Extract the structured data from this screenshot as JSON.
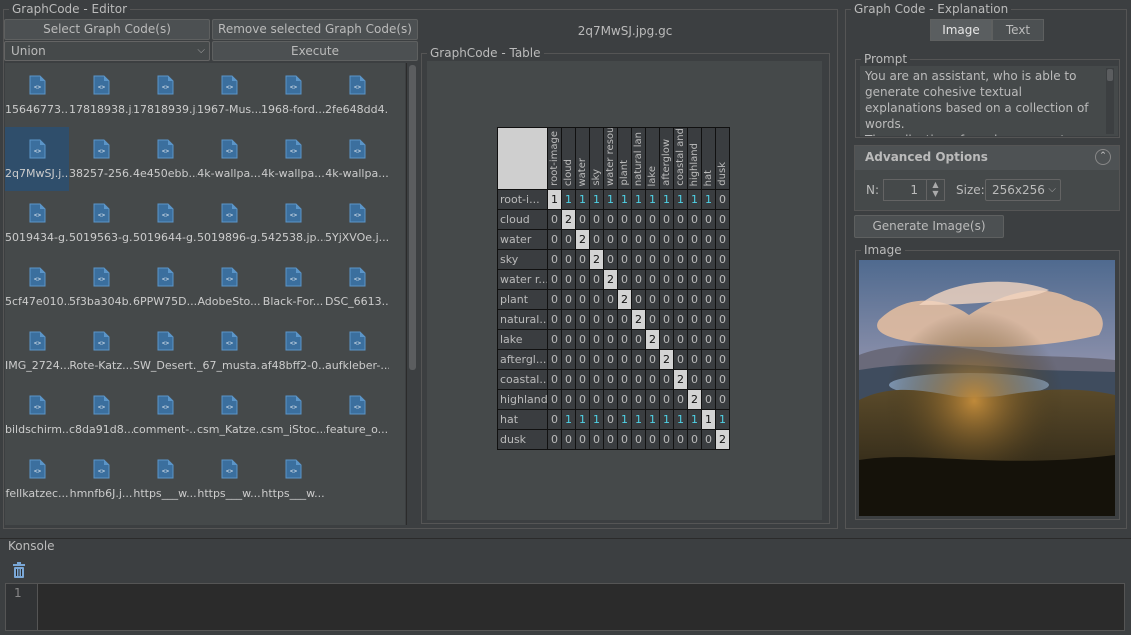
{
  "editor": {
    "title": "GraphCode - Editor",
    "select_button": "Select Graph Code(s)",
    "remove_button": "Remove selected Graph Code(s)",
    "mode_select": "Union",
    "execute_button": "Execute",
    "files": [
      "15646773...",
      "17818938.j...",
      "17818939.j...",
      "1967-Mus...",
      "1968-ford...",
      "2fe648dd4...",
      "2q7MwSJ.j...",
      "38257-256...",
      "4e450ebb...",
      "4k-wallpa...",
      "4k-wallpa...",
      "4k-wallpa...",
      "5019434-g...",
      "5019563-g...",
      "5019644-g...",
      "5019896-g...",
      "542538.jp...",
      "5YjXVOe.j...",
      "5cf47e010...",
      "5f3ba304b...",
      "6PPW75D...",
      "AdobeSto...",
      "Black-For...",
      "DSC_6613....",
      "IMG_2724....",
      "Rote-Katz...",
      "SW_Desert...",
      "_67_musta...",
      "af48bff2-0...",
      "aufkleber-...",
      "bildschirm...",
      "c8da91d8...",
      "comment-...",
      "csm_Katze...",
      "csm_iStoc...",
      "feature_o...",
      "fellkatzec...",
      "hmnfb6J.j...",
      "https___w...",
      "https___w...",
      "https___w..."
    ],
    "selected_file_index": 6
  },
  "table": {
    "file_title": "2q7MwSJ.jpg.gc",
    "title": "GraphCode - Table",
    "columns": [
      "root-image",
      "cloud",
      "water",
      "sky",
      "water resou.",
      "plant",
      "natural lan",
      "lake",
      "afterglow",
      "coastal and",
      "highland",
      "hat",
      "dusk"
    ],
    "row_labels": [
      "root-i...",
      "cloud",
      "water",
      "sky",
      "water r...",
      "plant",
      "natural...",
      "lake",
      "aftergl...",
      "coastal...",
      "highland",
      "hat",
      "dusk"
    ],
    "matrix": [
      [
        1,
        1,
        1,
        1,
        1,
        1,
        1,
        1,
        1,
        1,
        1,
        1,
        0
      ],
      [
        0,
        2,
        0,
        0,
        0,
        0,
        0,
        0,
        0,
        0,
        0,
        0,
        0
      ],
      [
        0,
        0,
        2,
        0,
        0,
        0,
        0,
        0,
        0,
        0,
        0,
        0,
        0
      ],
      [
        0,
        0,
        0,
        2,
        0,
        0,
        0,
        0,
        0,
        0,
        0,
        0,
        0
      ],
      [
        0,
        0,
        0,
        0,
        2,
        0,
        0,
        0,
        0,
        0,
        0,
        0,
        0
      ],
      [
        0,
        0,
        0,
        0,
        0,
        2,
        0,
        0,
        0,
        0,
        0,
        0,
        0
      ],
      [
        0,
        0,
        0,
        0,
        0,
        0,
        2,
        0,
        0,
        0,
        0,
        0,
        0
      ],
      [
        0,
        0,
        0,
        0,
        0,
        0,
        0,
        2,
        0,
        0,
        0,
        0,
        0
      ],
      [
        0,
        0,
        0,
        0,
        0,
        0,
        0,
        0,
        2,
        0,
        0,
        0,
        0
      ],
      [
        0,
        0,
        0,
        0,
        0,
        0,
        0,
        0,
        0,
        2,
        0,
        0,
        0
      ],
      [
        0,
        0,
        0,
        0,
        0,
        0,
        0,
        0,
        0,
        0,
        2,
        0,
        0
      ],
      [
        0,
        1,
        1,
        1,
        0,
        1,
        1,
        1,
        1,
        1,
        1,
        1,
        1
      ],
      [
        0,
        0,
        0,
        0,
        0,
        0,
        0,
        0,
        0,
        0,
        0,
        0,
        2
      ]
    ]
  },
  "explanation": {
    "title": "Graph Code - Explanation",
    "tab_image": "Image",
    "tab_text": "Text",
    "active_tab": "Image",
    "prompt_label": "Prompt",
    "prompt_text": "You are an assistant, who is able to generate cohesive textual explanations based on a collection of words.\nThe collection of words represents a",
    "advanced_label": "Advanced Options",
    "n_label": "N:",
    "n_value": "1",
    "size_label": "Size:",
    "size_value": "256x256",
    "generate_button": "Generate Image(s)",
    "image_label": "Image"
  },
  "console": {
    "title": "Konsole",
    "line_number": "1",
    "text": ""
  },
  "colors": {
    "background": "#3c3f41",
    "selection": "#2f4e6b",
    "accent_cyan": "#4fd2e6"
  }
}
